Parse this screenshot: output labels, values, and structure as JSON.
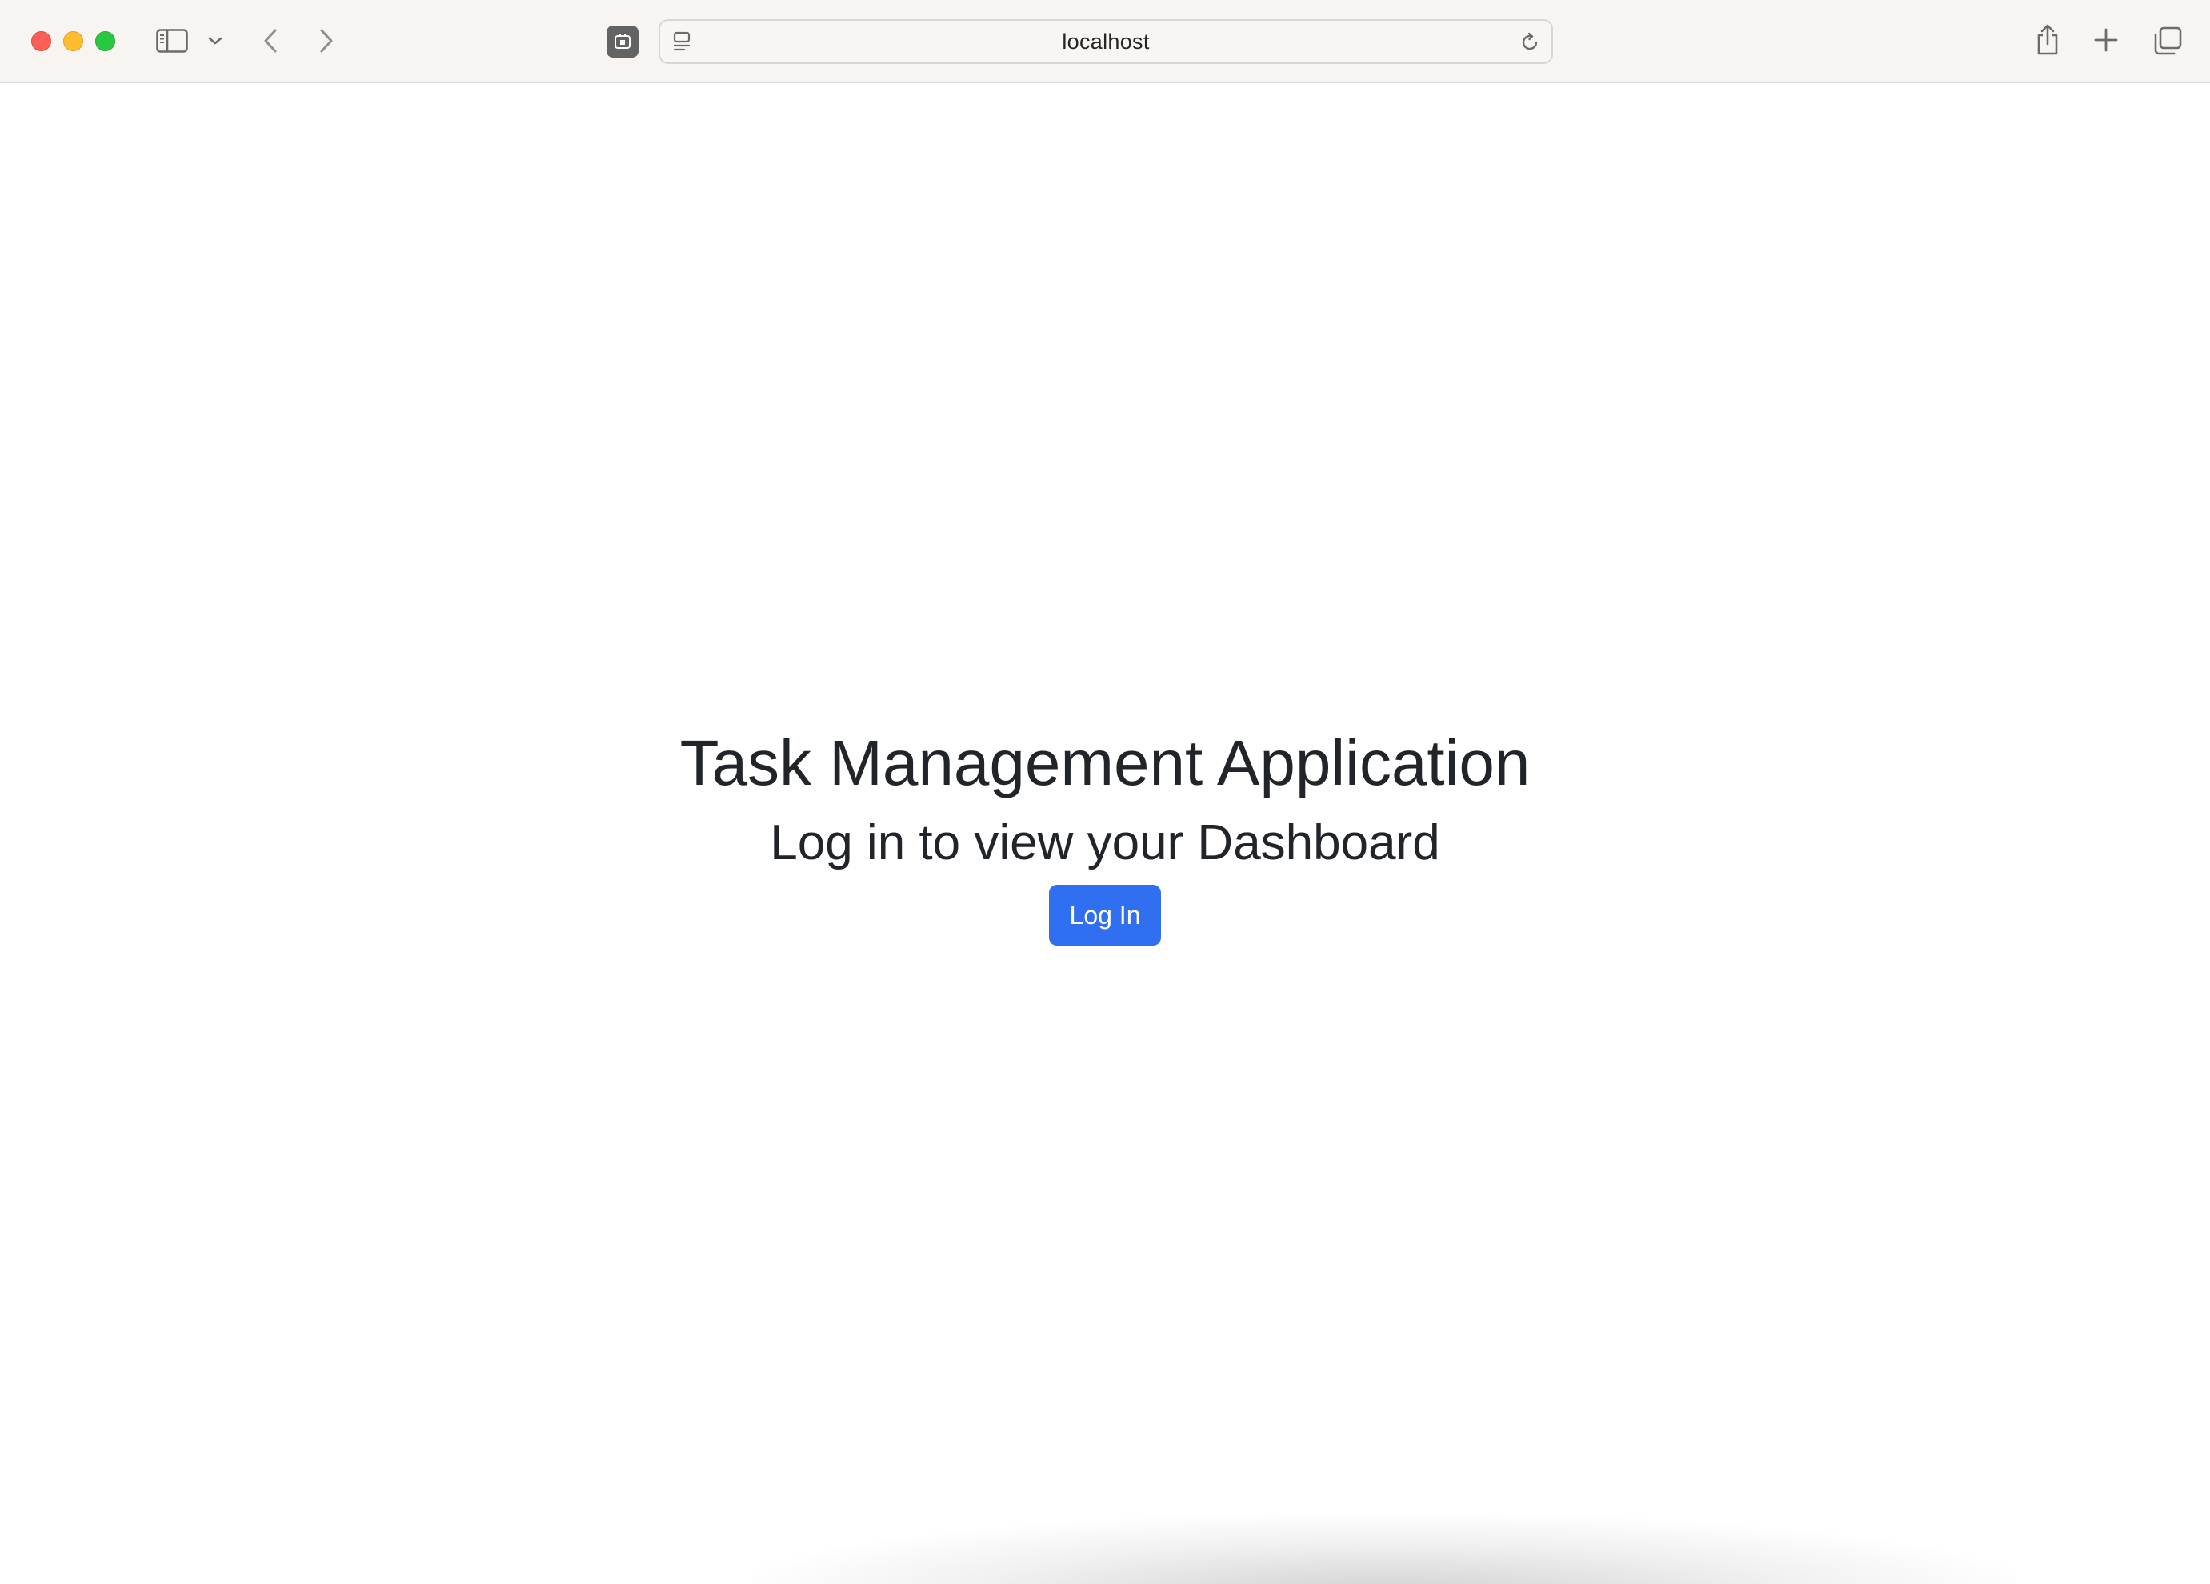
{
  "browser": {
    "url": "localhost",
    "icons": {
      "close": "close-dot",
      "minimize": "minimize-dot",
      "maximize": "maximize-dot",
      "sidebar": "sidebar-icon",
      "sidebar_menu": "chevron-down-icon",
      "back": "chevron-left-icon",
      "forward": "chevron-right-icon",
      "extension": "extension-icon",
      "reader": "reader-icon",
      "reload": "reload-icon",
      "share": "share-icon",
      "new_tab": "plus-icon",
      "tab_overview": "tabs-icon"
    }
  },
  "page": {
    "title": "Task Management Application",
    "subtitle": "Log in to view your Dashboard",
    "login_button": "Log In"
  },
  "colors": {
    "accent": "#2f6ff0",
    "text": "#212529",
    "toolbar_bg": "#f8f4f2"
  }
}
